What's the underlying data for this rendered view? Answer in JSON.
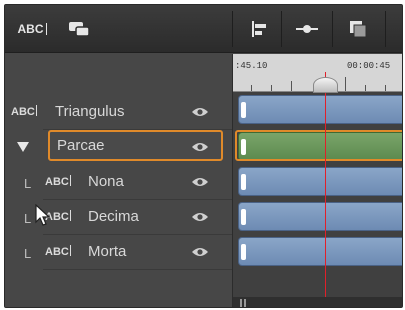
{
  "toolbar": {
    "title_tool_label": "ABC",
    "buttons": [
      {
        "name": "track-group-icon"
      },
      {
        "name": "align-icon"
      },
      {
        "name": "link-icon"
      },
      {
        "name": "overlay-icon"
      }
    ]
  },
  "ruler": {
    "left_timecode": ":45.10",
    "right_timecode": "00:00:45"
  },
  "tracks": [
    {
      "name": "Triangulus",
      "type_label": "ABC",
      "level": 0
    },
    {
      "name": "Parcae",
      "type_label": "",
      "level": 0,
      "expanded": true,
      "selected": true
    },
    {
      "name": "Nona",
      "type_label": "ABC",
      "level": 1,
      "branch": "L"
    },
    {
      "name": "Decima",
      "type_label": "ABC",
      "level": 1,
      "branch": "L"
    },
    {
      "name": "Morta",
      "type_label": "ABC",
      "level": 1,
      "branch": "L"
    }
  ],
  "colors": {
    "selection": "#e08a2a",
    "playhead": "#e0202a",
    "clip_blue": "#7a98be",
    "clip_green": "#6d9a5e"
  }
}
